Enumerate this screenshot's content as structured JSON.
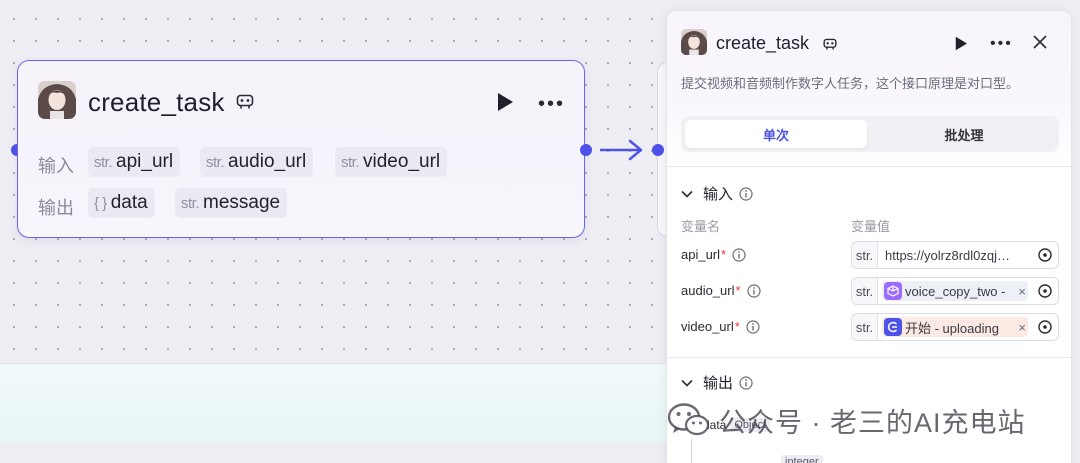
{
  "node": {
    "title": "create_task",
    "input_label": "输入",
    "output_label": "输出",
    "inputs": [
      {
        "type": "str.",
        "name": "api_url"
      },
      {
        "type": "str.",
        "name": "audio_url"
      },
      {
        "type": "str.",
        "name": "video_url"
      }
    ],
    "outputs": [
      {
        "type": "{ }",
        "name": "data"
      },
      {
        "type": "str.",
        "name": "message"
      }
    ]
  },
  "panel": {
    "title": "create_task",
    "description": "提交视频和音频制作数字人任务，这个接口原理是对口型。",
    "tabs": [
      "单次",
      "批处理"
    ],
    "active_tab": "单次",
    "input_section": "输入",
    "col_name": "变量名",
    "col_value": "变量值",
    "params": [
      {
        "name": "api_url",
        "type": "str.",
        "value": "https://yolrz8rdl0zqj…"
      },
      {
        "name": "audio_url",
        "type": "str.",
        "value": "voice_copy_two -"
      },
      {
        "name": "video_url",
        "type": "str.",
        "value": "开始 - uploading"
      }
    ],
    "output_section": "输出",
    "output_rows": [
      {
        "name": "data",
        "type": "Object"
      },
      {
        "name": "",
        "type": "integer"
      }
    ]
  },
  "watermark": "公众号 · 老三的AI充电站",
  "colors": {
    "accent": "#4d53e8",
    "node_border": "#6b67e6",
    "audio_ref_bg": "#9b6bff",
    "video_ref_bg": "#4d53e8"
  }
}
